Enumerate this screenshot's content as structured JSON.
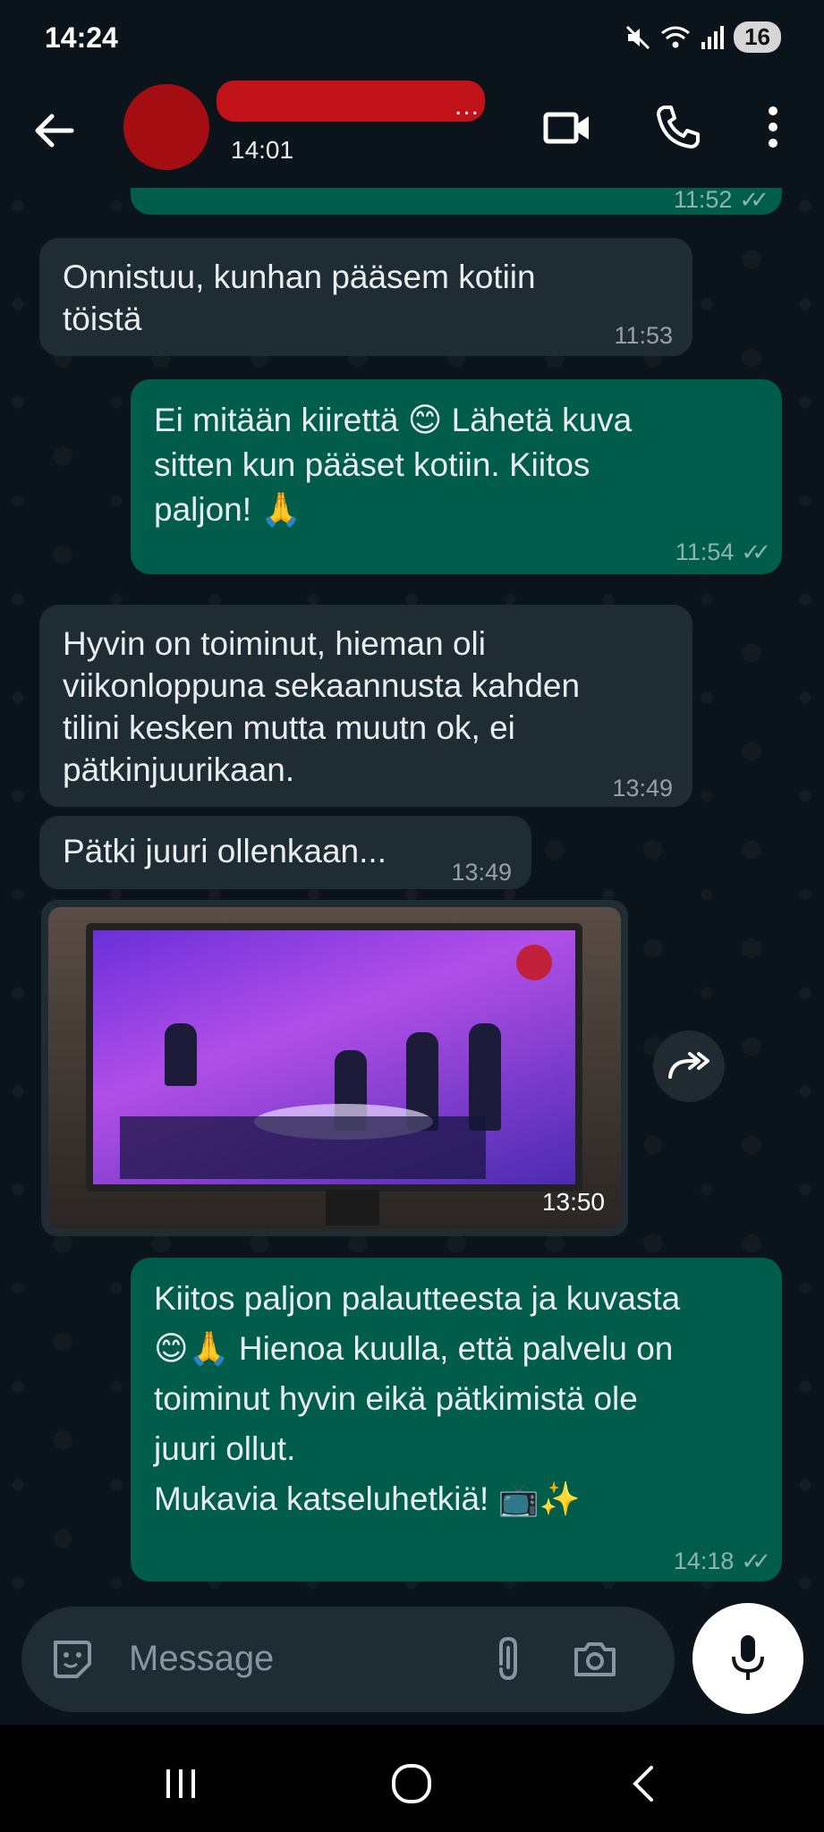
{
  "status_bar": {
    "time": "14:24",
    "battery": "16",
    "icons": [
      "mute-icon",
      "wifi-icon",
      "signal-icon"
    ]
  },
  "header": {
    "name_visible_tail": "...",
    "last_seen": "14:01",
    "icons": [
      "back-arrow-icon",
      "video-call-icon",
      "phone-icon",
      "more-vert-icon"
    ]
  },
  "messages": [
    {
      "dir": "out",
      "text": "",
      "time": "11:52",
      "ticks": true
    },
    {
      "dir": "in",
      "text": "Onnistuu, kunhan pääsem kotiin töistä",
      "time": "11:53"
    },
    {
      "dir": "out",
      "text": "Ei mitään kiirettä 😊 Lähetä kuva sitten kun pääset kotiin. Kiitos paljon! 🙏",
      "time": "11:54",
      "ticks": true
    },
    {
      "dir": "in",
      "text": "Hyvin on toiminut, hieman oli viikonloppuna sekaannusta kahden tilini kesken mutta muutn ok, ei pätkinjuurikaan.",
      "time": "13:49"
    },
    {
      "dir": "in",
      "text": "Pätki juuri ollenkaan...",
      "time": "13:49"
    },
    {
      "dir": "in",
      "type": "image",
      "time": "13:50"
    },
    {
      "dir": "out",
      "text": "Kiitos paljon palautteesta ja kuvasta 😊🙏 Hienoa kuulla, että palvelu on toiminut hyvin eikä pätkimistä ole juuri ollut.\nMukavia katseluhetkiä! 📺✨",
      "time": "14:18",
      "ticks": true
    }
  ],
  "msg_lines": {
    "m2_l1": "Onnistuu, kunhan pääsem kotiin",
    "m2_l2": "töistä",
    "m3_l1": "Ei mitään kiirettä 😊 Lähetä kuva",
    "m3_l2": "sitten kun pääset kotiin. Kiitos",
    "m3_l3": "paljon! 🙏",
    "m4_l1": "Hyvin on toiminut, hieman oli",
    "m4_l2": "viikonloppuna sekaannusta kahden",
    "m4_l3": "tilini kesken mutta muutn ok, ei",
    "m4_l4": "pätkinjuurikaan.",
    "m5_l1": "Pätki juuri ollenkaan...",
    "m7_l1": "Kiitos paljon palautteesta ja kuvasta",
    "m7_l2": "😊🙏  Hienoa kuulla, että palvelu on",
    "m7_l3": "toiminut hyvin eikä pätkimistä ole",
    "m7_l4": "juuri ollut.",
    "m7_l5": "Mukavia katseluhetkiä! 📺✨"
  },
  "input": {
    "placeholder": "Message",
    "icons": [
      "sticker-icon",
      "attach-icon",
      "camera-icon",
      "mic-icon"
    ]
  },
  "nav": [
    "recents-icon",
    "home-icon",
    "back-icon"
  ],
  "colors": {
    "background": "#0b141a",
    "incoming": "#202c33",
    "outgoing": "#005c4b",
    "avatar": "#a40e12"
  }
}
